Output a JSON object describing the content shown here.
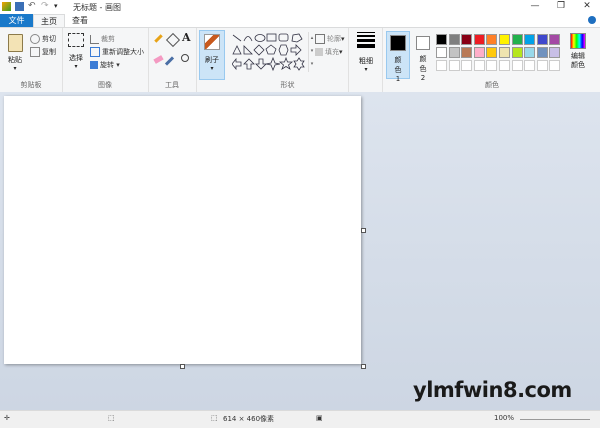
{
  "window": {
    "title": "无标题 - 画图"
  },
  "tabs": {
    "file": "文件",
    "home": "主页",
    "view": "查看"
  },
  "clipboard": {
    "paste": "粘贴",
    "cut": "剪切",
    "copy": "复制",
    "group": "剪贴板"
  },
  "image": {
    "select": "选择",
    "crop": "裁剪",
    "resize": "重新调整大小",
    "rotate": "旋转",
    "group": "图像"
  },
  "tools": {
    "group": "工具"
  },
  "brush": {
    "label": "刷子"
  },
  "shapes": {
    "outline": "轮廓",
    "fill": "填充",
    "group": "形状"
  },
  "size": {
    "label": "粗细"
  },
  "colors": {
    "color1": "颜色 1",
    "color2": "颜色 2",
    "edit": "编辑颜色",
    "group": "颜色",
    "palette_row1": [
      "#000000",
      "#7f7f7f",
      "#880015",
      "#ed1c24",
      "#ff7f27",
      "#fff200",
      "#22b14c",
      "#00a2e8",
      "#3f48cc",
      "#a349a4"
    ],
    "palette_row2": [
      "#ffffff",
      "#c3c3c3",
      "#b97a57",
      "#ffaec9",
      "#ffc90e",
      "#efe4b0",
      "#b5e61d",
      "#99d9ea",
      "#7092be",
      "#c8bfe7"
    ]
  },
  "status": {
    "dimensions": "614 × 460像素",
    "zoom": "100%"
  },
  "watermark": "ylmfwin8.com"
}
